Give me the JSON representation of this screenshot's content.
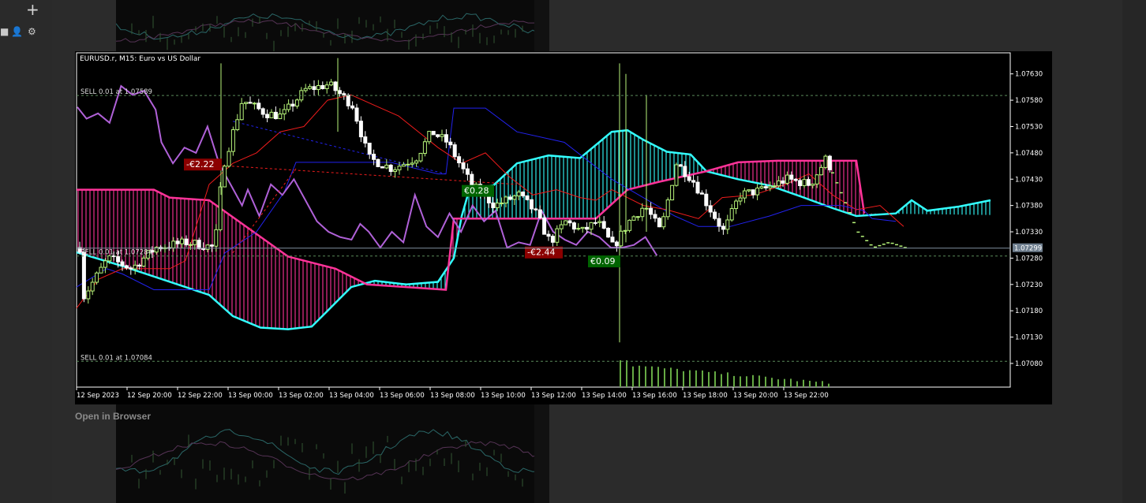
{
  "workspace": {
    "open_in_browser": "Open in Browser"
  },
  "chart_data": {
    "type": "candlestick",
    "title": "EURUSD.r, M15:  Euro vs US Dollar",
    "symbol": "EURUSD.r",
    "timeframe": "M15",
    "description": "Euro vs US Dollar",
    "ylim": [
      1.0703,
      1.0767
    ],
    "price_ticks": [
      "1.07630",
      "1.07580",
      "1.07530",
      "1.07480",
      "1.07430",
      "1.07380",
      "1.07330",
      "1.07280",
      "1.07230",
      "1.07180",
      "1.07130",
      "1.07080"
    ],
    "time_ticks": [
      "12 Sep 2023",
      "12 Sep 20:00",
      "12 Sep 22:00",
      "13 Sep 00:00",
      "13 Sep 02:00",
      "13 Sep 04:00",
      "13 Sep 06:00",
      "13 Sep 08:00",
      "13 Sep 10:00",
      "13 Sep 12:00",
      "13 Sep 14:00",
      "13 Sep 16:00",
      "13 Sep 18:00",
      "13 Sep 20:00",
      "13 Sep 22:00"
    ],
    "current_price": "1.07299",
    "trade_levels": [
      {
        "label": "SELL 0.01 at 1.07589",
        "price": 1.07589
      },
      {
        "label": "SELL 0.01 at 1.07284",
        "price": 1.07284
      },
      {
        "label": "SELL 0.01 at 1.07084",
        "price": 1.07084
      }
    ],
    "profit_tags": [
      {
        "text": "-€2.22",
        "x_index": 2.3,
        "price": 1.07457,
        "kind": "loss"
      },
      {
        "text": "€0.28",
        "x_index": 7.6,
        "price": 1.07407,
        "kind": "profit"
      },
      {
        "text": "-€2.44",
        "x_index": 9.2,
        "price": 1.0729,
        "kind": "loss"
      },
      {
        "text": "€0.09",
        "x_index": 10.4,
        "price": 1.07273,
        "kind": "profit"
      }
    ],
    "grid": false,
    "colors": {
      "bull": "#b7f57a",
      "bear": "#ffffff",
      "cloud_up": "#33ffff",
      "cloud_down": "#ff3399",
      "lagging": "#b061d8",
      "tenkan": "#ee1c1c",
      "kijun": "#2222ee",
      "trade_line": "#5a8a5a",
      "loss_tag": "#8b0000",
      "profit_tag": "#006400",
      "volume": "#66aa44"
    }
  }
}
